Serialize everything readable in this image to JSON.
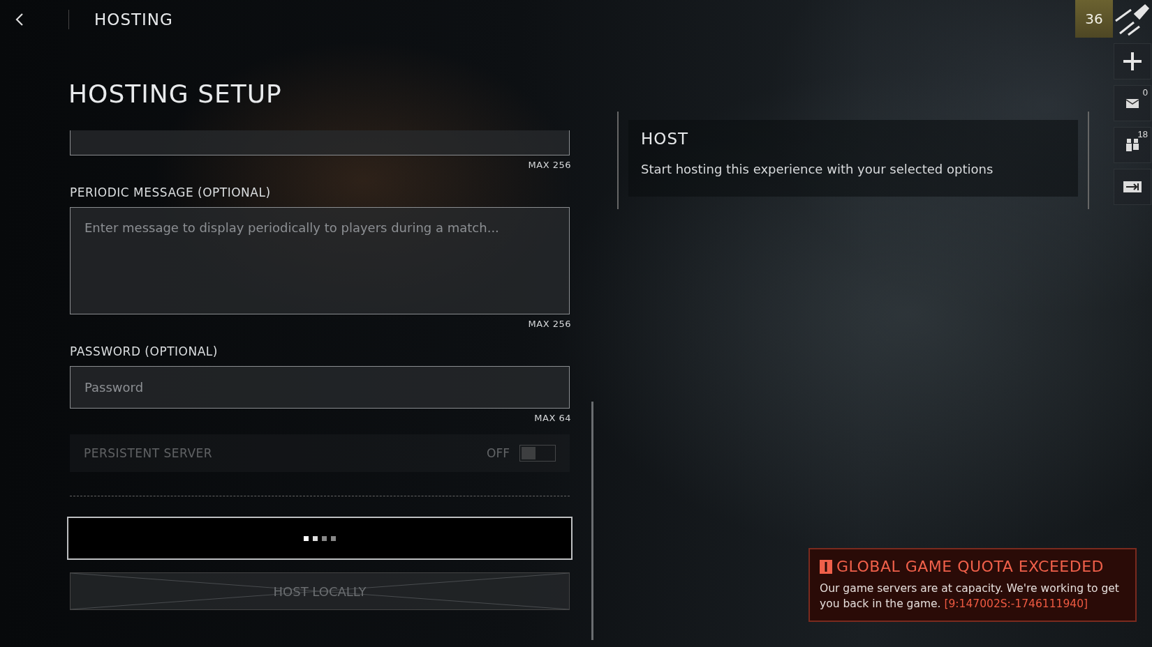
{
  "header": {
    "title": "HOSTING"
  },
  "page_title": "HOSTING SETUP",
  "fields": [
    {
      "kind": "input",
      "counter": "MAX 256"
    },
    {
      "kind": "textarea",
      "label": "PERIODIC MESSAGE (OPTIONAL)",
      "placeholder": "Enter message to display periodically to players during a match...",
      "counter": "MAX 256"
    },
    {
      "kind": "input",
      "label": "PASSWORD (OPTIONAL)",
      "placeholder": "Password",
      "counter": "MAX 64"
    }
  ],
  "persistent_server": {
    "label": "PERSISTENT SERVER",
    "state_text": "OFF",
    "on": false,
    "disabled": true
  },
  "host_button": {
    "loading": true
  },
  "host_locally_button": {
    "label": "HOST LOCALLY",
    "disabled": true
  },
  "host_panel": {
    "title": "HOST",
    "description": "Start hosting this experience with your selected options"
  },
  "rail": {
    "rank": "36",
    "items": [
      {
        "kind": "add"
      },
      {
        "kind": "mail",
        "count": "0"
      },
      {
        "kind": "friends",
        "count": "18"
      },
      {
        "kind": "exit"
      }
    ]
  },
  "notification": {
    "title": "GLOBAL GAME QUOTA EXCEEDED",
    "message": "Our game servers are at capacity. We're working to get you back in the game.",
    "code": "[9:147002S:-1746111940]"
  }
}
